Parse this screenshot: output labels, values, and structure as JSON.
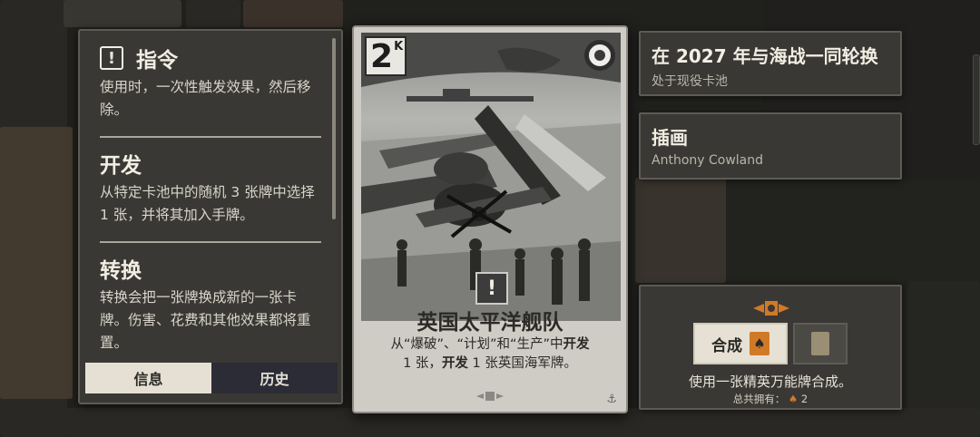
{
  "keywords": [
    {
      "title": "指令",
      "icon": "exclamation-box-icon",
      "desc": "使用时，一次性触发效果，然后移除。"
    },
    {
      "title": "开发",
      "icon": "",
      "desc": "从特定卡池中的随机 3 张牌中选择 1 张，并将其加入手牌。"
    },
    {
      "title": "转换",
      "icon": "",
      "desc": "转换会把一张牌换成新的一张卡牌。伤害、花费和其他效果都将重置。"
    }
  ],
  "tabs": {
    "info": "信息",
    "history": "历史"
  },
  "card": {
    "cost": "2",
    "rarity": "K",
    "name": "英国太平洋舰队",
    "text_line1": "从“爆破”、“计划”和“生产”中",
    "text_bold1": "开发",
    "text_line2": "1 张，",
    "text_bold2": "开发",
    "text_line3": " 1 张英国海军牌。",
    "type_icon": "!",
    "nation": "uk-roundel-icon"
  },
  "rotation": {
    "title": "在 2027 年与海战一同轮换",
    "sub": "处于现役卡池"
  },
  "illustration": {
    "title": "插画",
    "artist": "Anthony Cowland"
  },
  "craft": {
    "button_label": "合成",
    "description": "使用一张精英万能牌合成。",
    "owned_label": "总共拥有：",
    "owned_count": "2"
  },
  "colors": {
    "accent": "#d07a28",
    "panel": "#3a3834",
    "card": "#cfccc5"
  }
}
